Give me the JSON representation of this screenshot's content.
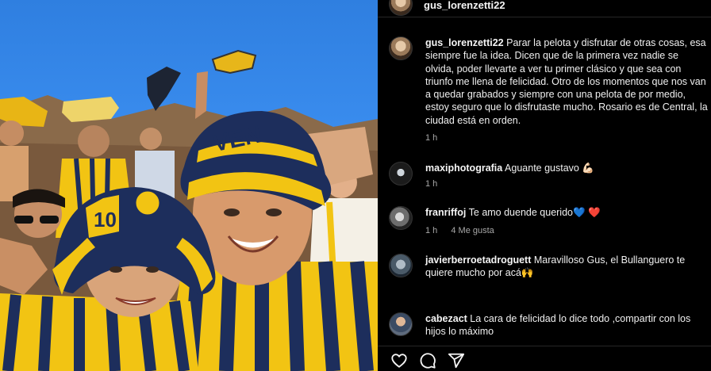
{
  "post_author": "gus_lorenzetti22",
  "caption": {
    "username": "gus_lorenzetti22",
    "text": "Parar la pelota y disfrutar de otras cosas, esa siempre fue la idea. Dicen que de la primera vez nadie se olvida, poder llevarte a ver tu primer clásico y que sea con triunfo me llena de felicidad. Otro de los momentos que nos van a quedar grabados y siempre con una pelota de por medio, estoy seguro que lo disfrutaste mucho. Rosario es de Central, la ciudad está en orden.",
    "time": "1 h"
  },
  "comments": [
    {
      "username": "maxiphotografia",
      "text": "Aguante gustavo 💪🏻",
      "time": "1 h",
      "likes": ""
    },
    {
      "username": "franriffoj",
      "text": "Te amo duende querido💙 ❤️",
      "time": "1 h",
      "likes": "4 Me gusta"
    },
    {
      "username": "javierberroetadroguett",
      "text": "Maravilloso Gus, el Bullanguero te quiere mucho por acá🙌",
      "time": "",
      "likes": ""
    },
    {
      "username": "cabezact",
      "text": "La cara de felicidad lo dice todo ,compartir con los hijos lo máximo",
      "time": "",
      "likes": ""
    }
  ],
  "photo_text": {
    "hat_text": "VEN",
    "hat_number": "10"
  },
  "colors": {
    "background": "#000000",
    "muted": "#a8a8a8",
    "club_yellow": "#f2c413",
    "club_blue": "#1d2e5c"
  },
  "icons": [
    "heart-icon",
    "comment-icon",
    "share-icon"
  ]
}
